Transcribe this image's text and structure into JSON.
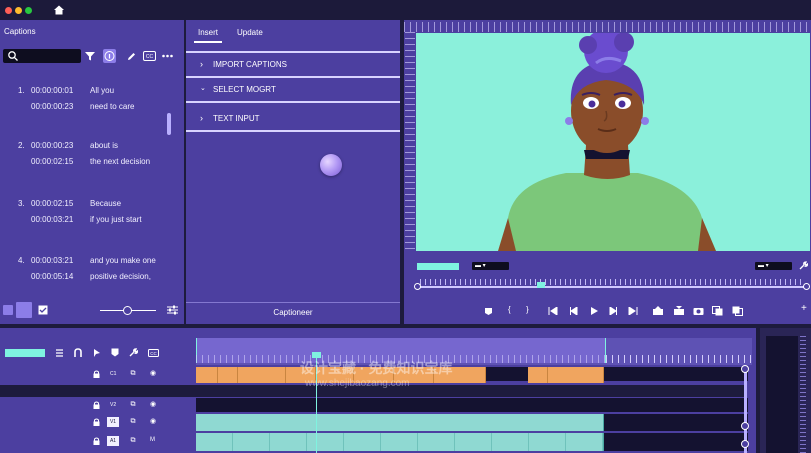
{
  "captions_panel": {
    "title": "Captions",
    "items": [
      {
        "index": "1.",
        "tc_in": "00:00:00:01",
        "tc_out": "00:00:00:23",
        "line1": "All you",
        "line2": "need to care"
      },
      {
        "index": "2.",
        "tc_in": "00:00:00:23",
        "tc_out": "00:00:02:15",
        "line1": "about is",
        "line2": "the next decision"
      },
      {
        "index": "3.",
        "tc_in": "00:00:02:15",
        "tc_out": "00:00:03:21",
        "line1": "Because",
        "line2": "if you just start"
      },
      {
        "index": "4.",
        "tc_in": "00:00:03:21",
        "tc_out": "00:00:05:14",
        "line1": "and you make one",
        "line2": "positive decision,"
      }
    ]
  },
  "captioneer_panel": {
    "tabs": [
      "Insert",
      "Update"
    ],
    "active_tab": "Insert",
    "sections": [
      "IMPORT CAPTIONS",
      "SELECT MOGRT",
      "TEXT INPUT"
    ],
    "footer": "Captioneer"
  },
  "timeline": {
    "tracks": [
      {
        "label": "C1"
      },
      {
        "label": "V2"
      },
      {
        "label": "V1"
      },
      {
        "label": "A1",
        "extra": "M"
      }
    ]
  },
  "colors": {
    "panel": "#4c3fa0",
    "accent": "#7ff3e0",
    "clip_caption": "#f0a55f",
    "clip_video": "#8fd9d2",
    "video_bg": "#8bf0db"
  },
  "watermark": {
    "line1": "设计宝藏 · 免费知识宝库",
    "line2": "www.shejibaozang.com"
  }
}
